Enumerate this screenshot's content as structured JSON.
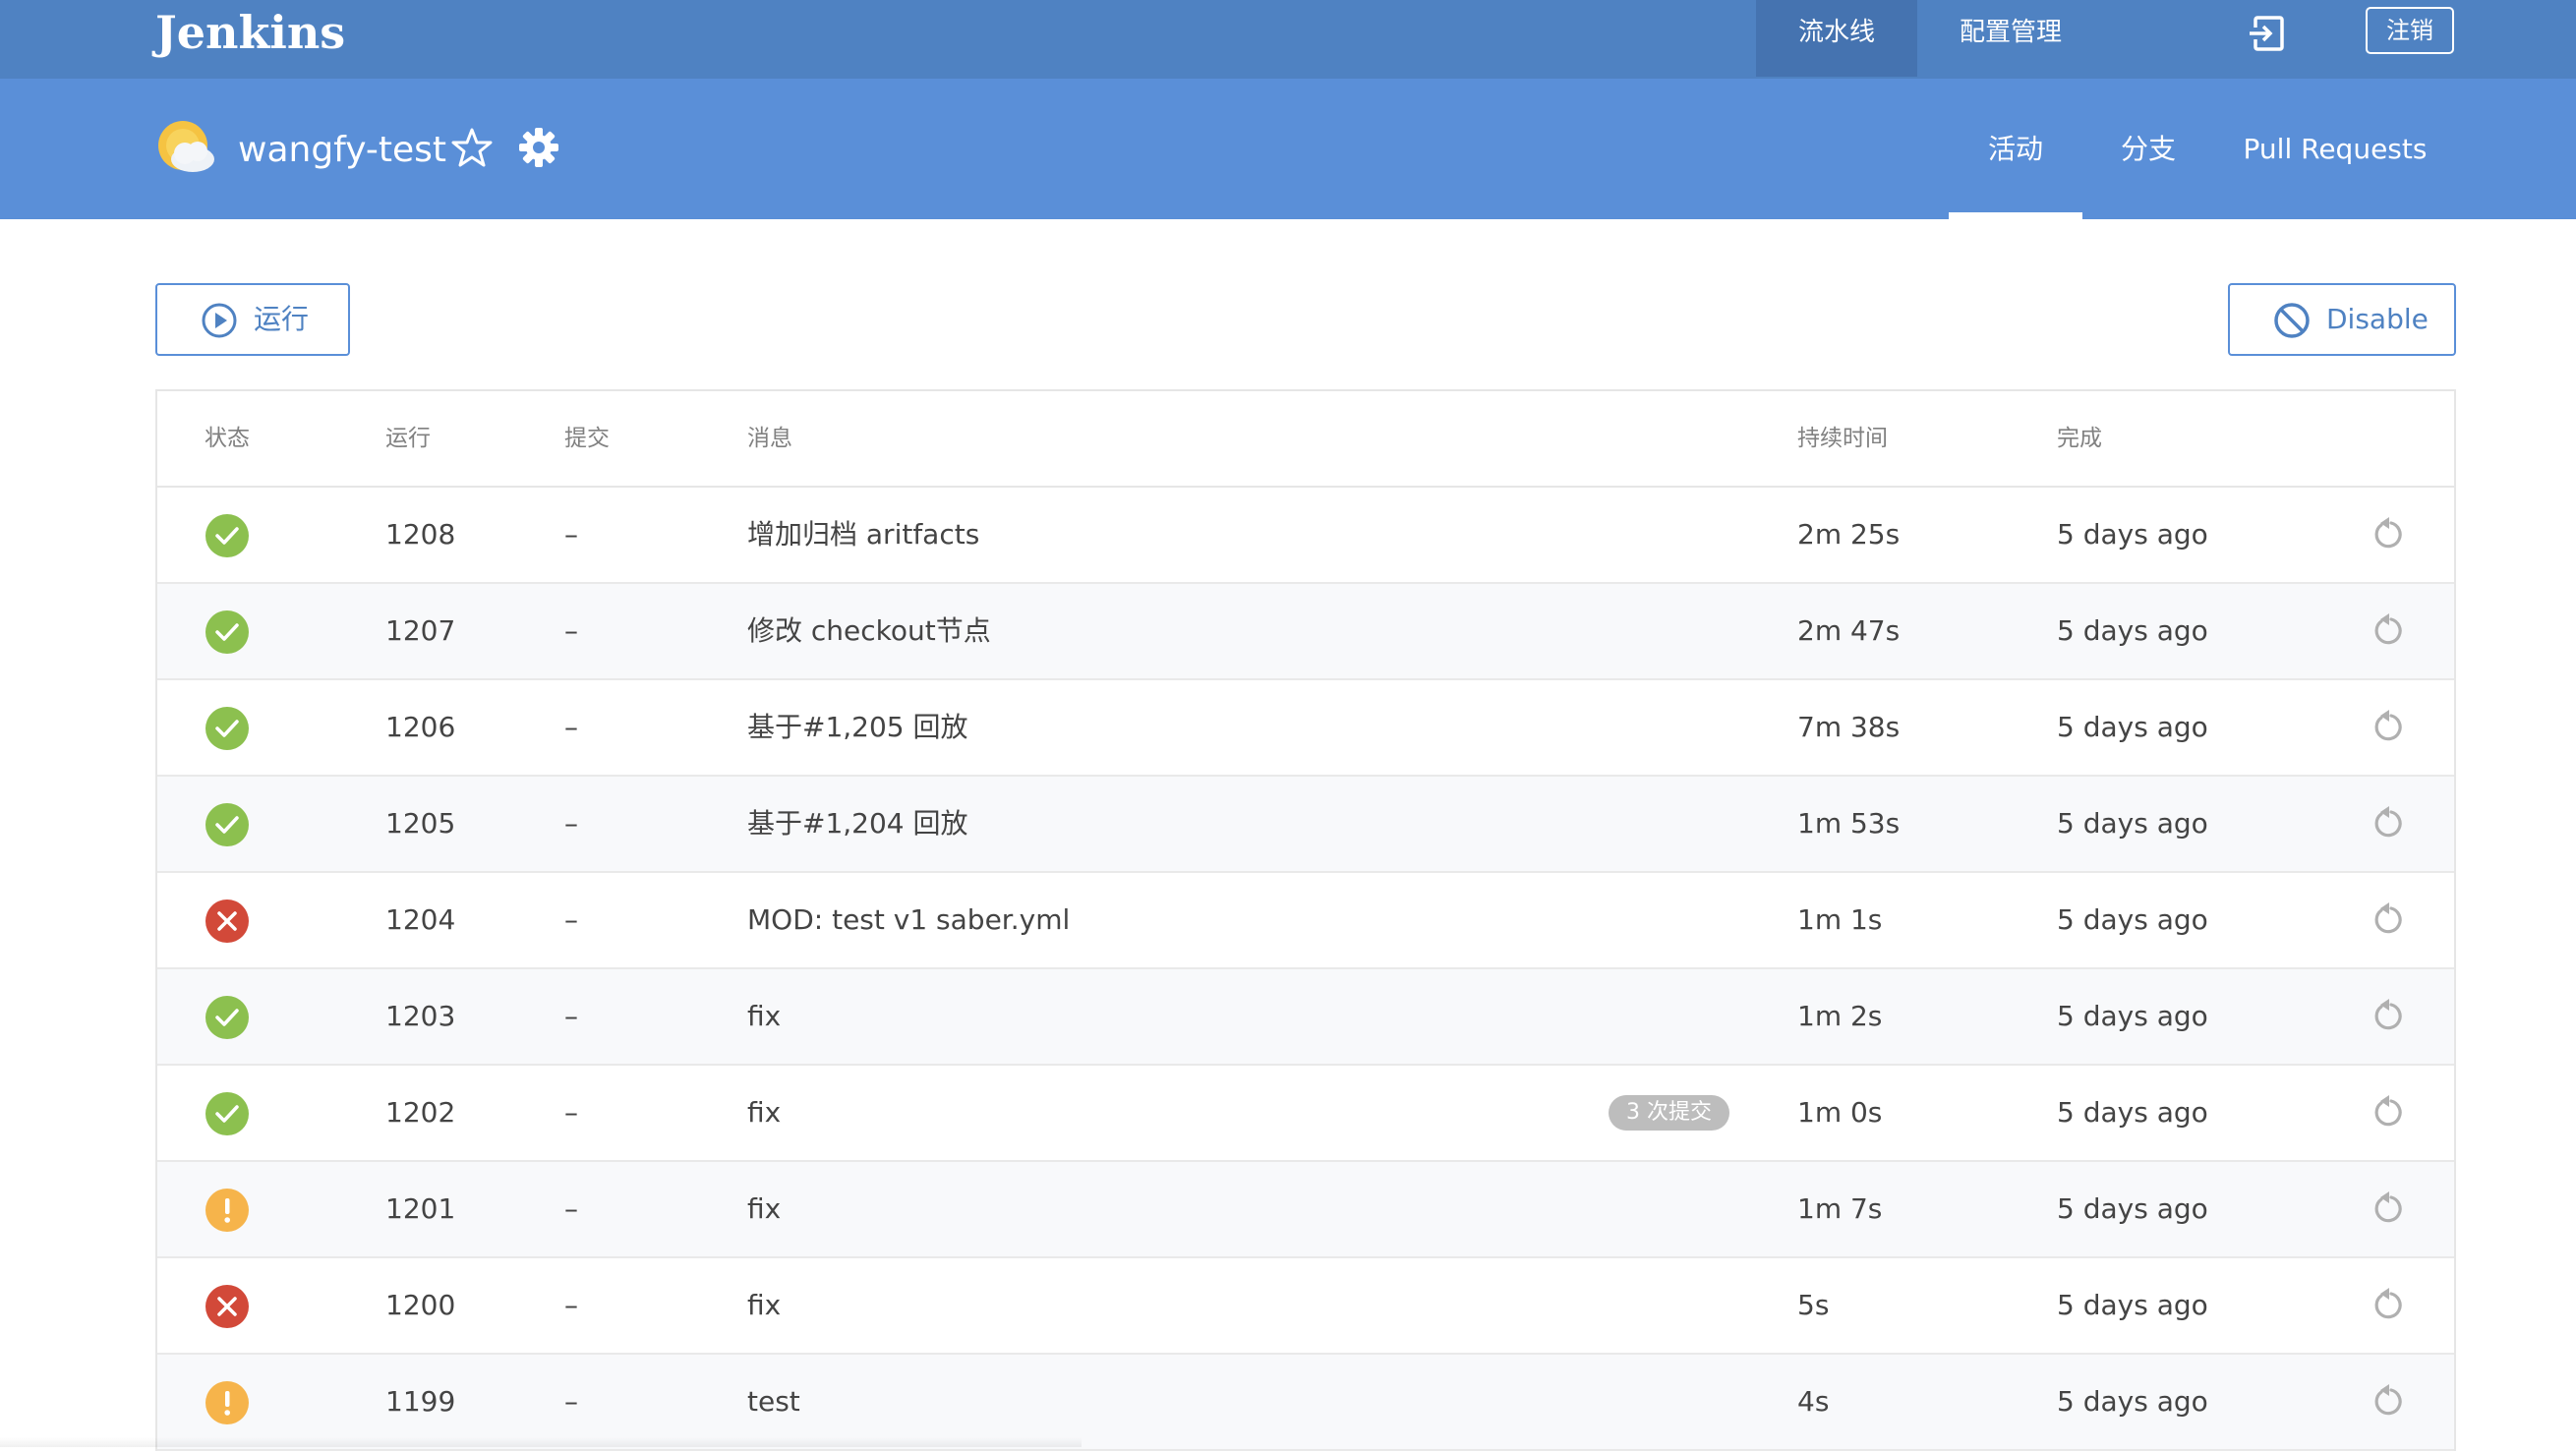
{
  "header": {
    "logo": "Jenkins",
    "nav": [
      {
        "label": "流水线",
        "active": true
      },
      {
        "label": "配置管理",
        "active": false
      }
    ],
    "exit_icon": "exit-icon",
    "logout_label": "注销"
  },
  "subheader": {
    "weather_icon": "partly-cloudy-icon",
    "job_name": "wangfy-test",
    "tabs": [
      {
        "label": "活动",
        "active": true
      },
      {
        "label": "分支",
        "active": false
      },
      {
        "label": "Pull Requests",
        "active": false
      }
    ]
  },
  "actions": {
    "run_label": "运行",
    "disable_label": "Disable"
  },
  "table": {
    "columns": [
      "状态",
      "运行",
      "提交",
      "消息",
      "持续时间",
      "完成"
    ],
    "rows": [
      {
        "status": "success",
        "run": "1208",
        "commit": "–",
        "message": "增加归档 aritfacts",
        "badge": "",
        "duration": "2m 25s",
        "completed": "5 days ago"
      },
      {
        "status": "success",
        "run": "1207",
        "commit": "–",
        "message": "修改 checkout节点",
        "badge": "",
        "duration": "2m 47s",
        "completed": "5 days ago"
      },
      {
        "status": "success",
        "run": "1206",
        "commit": "–",
        "message": "基于#1,205 回放",
        "badge": "",
        "duration": "7m 38s",
        "completed": "5 days ago"
      },
      {
        "status": "success",
        "run": "1205",
        "commit": "–",
        "message": "基于#1,204 回放",
        "badge": "",
        "duration": "1m 53s",
        "completed": "5 days ago"
      },
      {
        "status": "failure",
        "run": "1204",
        "commit": "–",
        "message": "MOD: test v1 saber.yml",
        "badge": "",
        "duration": "1m 1s",
        "completed": "5 days ago"
      },
      {
        "status": "success",
        "run": "1203",
        "commit": "–",
        "message": "fix",
        "badge": "",
        "duration": "1m 2s",
        "completed": "5 days ago"
      },
      {
        "status": "success",
        "run": "1202",
        "commit": "–",
        "message": "fix",
        "badge": "3 次提交",
        "duration": "1m 0s",
        "completed": "5 days ago"
      },
      {
        "status": "unstable",
        "run": "1201",
        "commit": "–",
        "message": "fix",
        "badge": "",
        "duration": "1m 7s",
        "completed": "5 days ago"
      },
      {
        "status": "failure",
        "run": "1200",
        "commit": "–",
        "message": "fix",
        "badge": "",
        "duration": "5s",
        "completed": "5 days ago"
      },
      {
        "status": "unstable",
        "run": "1199",
        "commit": "–",
        "message": "test",
        "badge": "",
        "duration": "4s",
        "completed": "5 days ago"
      }
    ]
  },
  "colors": {
    "header_bg": "#4f82c2",
    "subheader_bg": "#5a8fd8",
    "success": "#8cc04f",
    "failure": "#d24939",
    "unstable": "#f6b44b",
    "replay": "#b0b0b0"
  }
}
